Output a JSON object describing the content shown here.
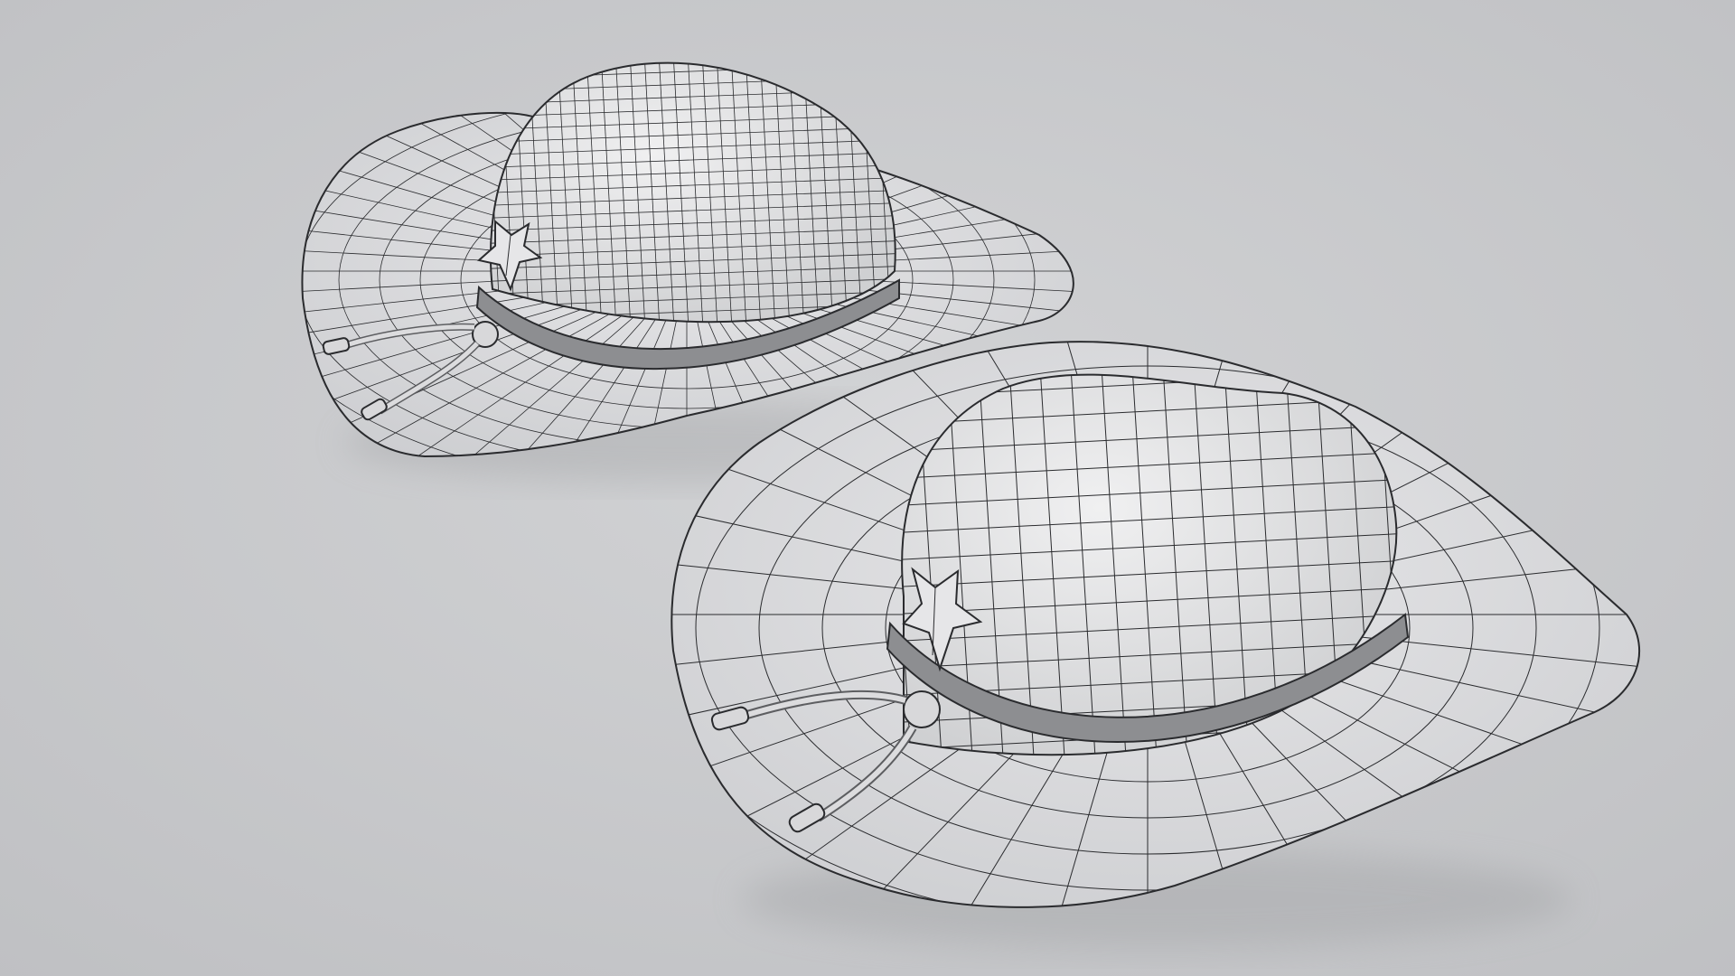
{
  "scene": {
    "background_color": "#c9cacc",
    "surface_color": "#e2e2e4",
    "shadow_color": "#9a9b9e",
    "wire_color": "#2a2b2e",
    "objects": [
      {
        "name": "hat-wireframe-low-detail",
        "mesh": "dense"
      },
      {
        "name": "hat-wireframe-low-poly",
        "mesh": "sparse"
      }
    ]
  }
}
